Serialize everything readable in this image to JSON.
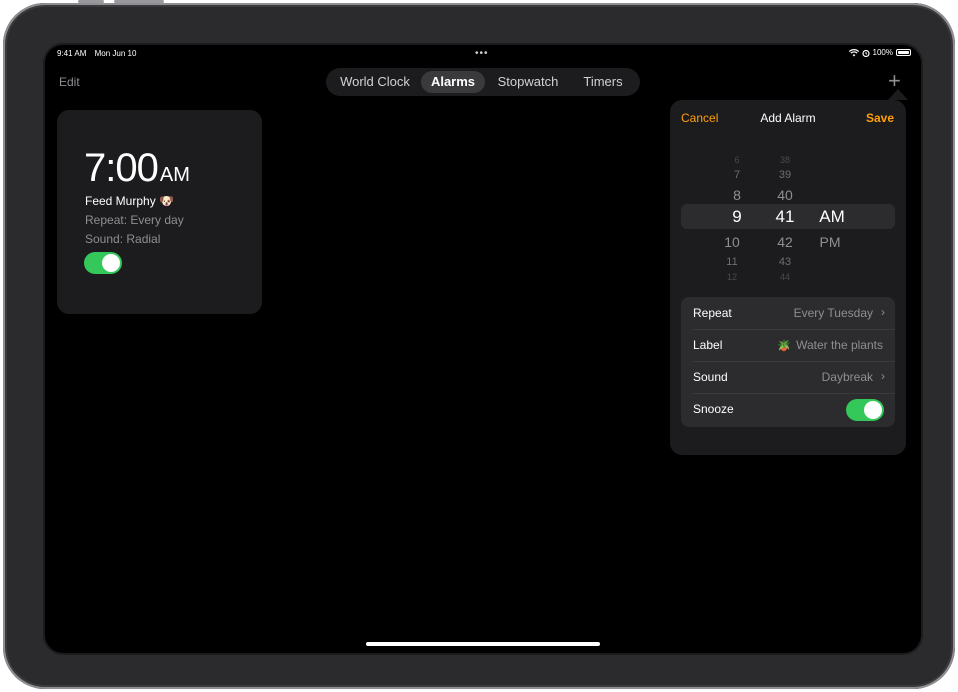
{
  "status_bar": {
    "time": "9:41 AM",
    "date": "Mon Jun 10",
    "battery": "100%"
  },
  "nav": {
    "edit_label": "Edit",
    "tabs": [
      {
        "label": "World Clock"
      },
      {
        "label": "Alarms",
        "active": true
      },
      {
        "label": "Stopwatch"
      },
      {
        "label": "Timers"
      }
    ]
  },
  "alarm": {
    "time": "7:00",
    "ampm": "AM",
    "label": "Feed Murphy 🐶",
    "repeat": "Repeat: Every day",
    "sound": "Sound: Radial",
    "enabled": true
  },
  "add_alarm": {
    "cancel": "Cancel",
    "title": "Add Alarm",
    "save": "Save",
    "hours": [
      "6",
      "7",
      "8",
      "9",
      "10",
      "11",
      "12"
    ],
    "minutes": [
      "38",
      "39",
      "40",
      "41",
      "42",
      "43",
      "44"
    ],
    "periods": [
      "AM",
      "PM"
    ],
    "selected_hour": "9",
    "selected_minute": "41",
    "selected_period": "AM",
    "rows": {
      "repeat": {
        "label": "Repeat",
        "value": "Every Tuesday"
      },
      "label": {
        "label": "Label",
        "value": "Water the plants"
      },
      "sound": {
        "label": "Sound",
        "value": "Daybreak"
      },
      "snooze": {
        "label": "Snooze",
        "enabled": true
      }
    }
  },
  "colors": {
    "accent": "#ff9f0a",
    "toggle_on": "#34c759",
    "background": "#000000",
    "card": "#1c1c1e"
  },
  "icons": [
    "wifi-icon",
    "alarm-status-icon",
    "battery-icon",
    "plus-icon",
    "chevron-right-icon",
    "potted-plant-icon"
  ]
}
